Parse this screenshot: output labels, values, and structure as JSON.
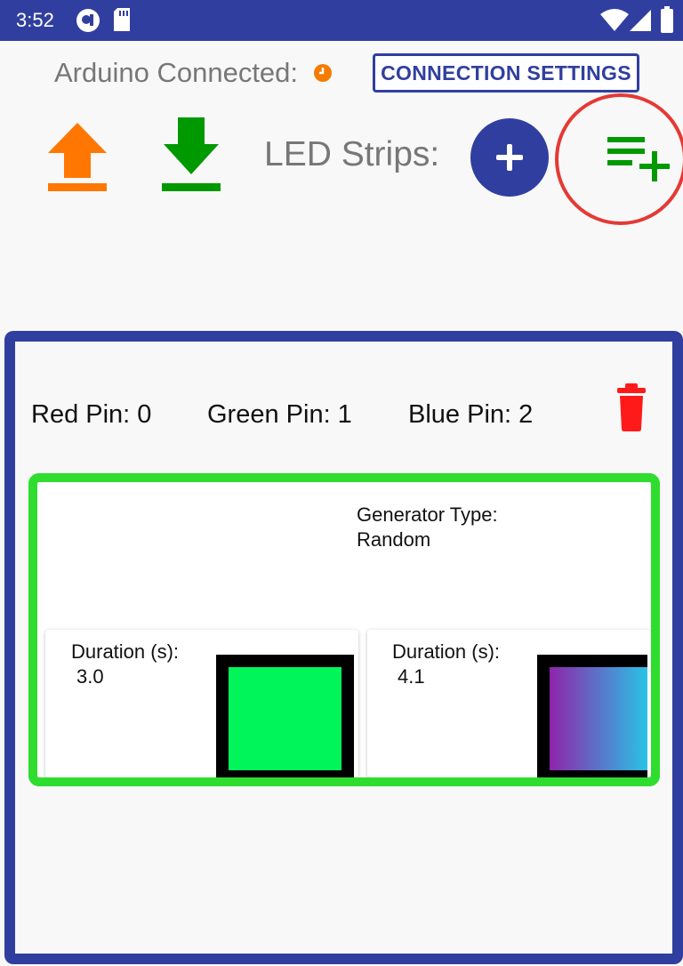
{
  "status_bar": {
    "time": "3:52",
    "icons": [
      "app-notification-icon",
      "sd-card-icon",
      "wifi-icon",
      "signal-icon",
      "battery-icon"
    ]
  },
  "header": {
    "connection_label": "Arduino Connected:",
    "connection_status_color": "#f57c00",
    "connection_settings_label": "CONNECTION SETTINGS",
    "strips_label": "LED Strips:",
    "upload_color": "#ff7700",
    "download_color": "#009900",
    "add_list_color": "#009900",
    "accent": "#303f9f"
  },
  "strip": {
    "red_pin_label": "Red Pin: 0",
    "green_pin_label": "Green Pin: 1",
    "blue_pin_label": "Blue Pin: 2",
    "delete_color": "#ff1a1a"
  },
  "generator": {
    "type_label": "Generator Type:",
    "type_value": "Random",
    "border_color": "#2fdd2f",
    "colors": [
      {
        "duration_label": "Duration (s):",
        "duration_value": "3.0",
        "swatch": "solid",
        "color": "#00f55a"
      },
      {
        "duration_label": "Duration (s):",
        "duration_value": "4.1",
        "swatch": "gradient",
        "gradient_from": "#8e24aa",
        "gradient_to": "#29c3e6"
      }
    ]
  }
}
